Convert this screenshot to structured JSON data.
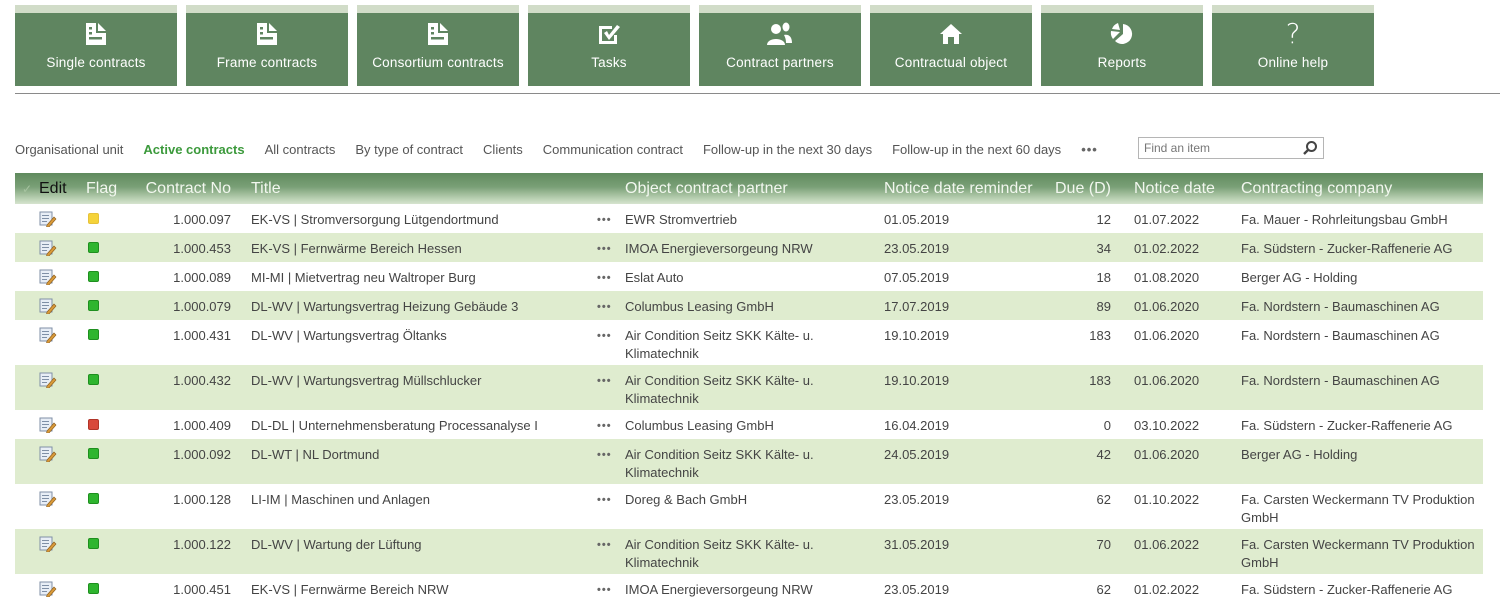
{
  "nav_tiles": [
    {
      "label": "Single contracts",
      "icon": "document-icon"
    },
    {
      "label": "Frame contracts",
      "icon": "document-icon"
    },
    {
      "label": "Consortium contracts",
      "icon": "document-icon"
    },
    {
      "label": "Tasks",
      "icon": "checkbox-icon"
    },
    {
      "label": "Contract partners",
      "icon": "people-icon"
    },
    {
      "label": "Contractual object",
      "icon": "home-icon"
    },
    {
      "label": "Reports",
      "icon": "pie-chart-icon"
    },
    {
      "label": "Online help",
      "icon": "question-icon",
      "glyph": "?"
    }
  ],
  "views": {
    "items": [
      {
        "label": "Organisational unit",
        "active": false
      },
      {
        "label": "Active contracts",
        "active": true
      },
      {
        "label": "All contracts",
        "active": false
      },
      {
        "label": "By type of contract",
        "active": false
      },
      {
        "label": "Clients",
        "active": false
      },
      {
        "label": "Communication contract",
        "active": false
      },
      {
        "label": "Follow-up in the next 30 days",
        "active": false
      },
      {
        "label": "Follow-up in the next 60 days",
        "active": false
      }
    ],
    "more": "•••"
  },
  "search": {
    "placeholder": "Find an item",
    "value": ""
  },
  "table": {
    "columns": {
      "select": "✓",
      "edit": "Edit",
      "flag": "Flag",
      "contract_no": "Contract No",
      "title": "Title",
      "partner": "Object contract partner",
      "reminder": "Notice date reminder",
      "due": "Due (D)",
      "notice": "Notice date",
      "company": "Contracting company"
    },
    "row_menu": "•••",
    "flag_colors": {
      "yellow": "#f5d33a",
      "green": "#2fb52f",
      "red": "#d8483a"
    },
    "rows": [
      {
        "flag": "yellow",
        "contract_no": "1.000.097",
        "title": "EK-VS | Stromversorgung Lütgendortmund",
        "partner": "EWR Stromvertrieb",
        "reminder": "01.05.2019",
        "due": "12",
        "notice": "01.07.2022",
        "company": "Fa. Mauer - Rohrleitungsbau GmbH"
      },
      {
        "flag": "green",
        "contract_no": "1.000.453",
        "title": "EK-VS | Fernwärme Bereich Hessen",
        "partner": "IMOA Energieversorgeung NRW",
        "reminder": "23.05.2019",
        "due": "34",
        "notice": "01.02.2022",
        "company": "Fa. Südstern - Zucker-Raffenerie AG"
      },
      {
        "flag": "green",
        "contract_no": "1.000.089",
        "title": "MI-MI | Mietvertrag neu Waltroper Burg",
        "partner": "Eslat Auto",
        "reminder": "07.05.2019",
        "due": "18",
        "notice": "01.08.2020",
        "company": "Berger AG - Holding"
      },
      {
        "flag": "green",
        "contract_no": "1.000.079",
        "title": "DL-WV | Wartungsvertrag Heizung Gebäude 3",
        "partner": "Columbus Leasing GmbH",
        "reminder": "17.07.2019",
        "due": "89",
        "notice": "01.06.2020",
        "company": "Fa. Nordstern - Baumaschinen AG"
      },
      {
        "flag": "green",
        "contract_no": "1.000.431",
        "title": "DL-WV | Wartungsvertrag Öltanks",
        "partner": "Air Condition Seitz SKK Kälte- u. Klimatechnik",
        "reminder": "19.10.2019",
        "due": "183",
        "notice": "01.06.2020",
        "company": "Fa. Nordstern - Baumaschinen AG"
      },
      {
        "flag": "green",
        "contract_no": "1.000.432",
        "title": "DL-WV | Wartungsvertrag Müllschlucker",
        "partner": "Air Condition Seitz SKK Kälte- u. Klimatechnik",
        "reminder": "19.10.2019",
        "due": "183",
        "notice": "01.06.2020",
        "company": "Fa. Nordstern - Baumaschinen AG"
      },
      {
        "flag": "red",
        "contract_no": "1.000.409",
        "title": "DL-DL | Unternehmensberatung Processanalyse I",
        "partner": "Columbus Leasing GmbH",
        "reminder": "16.04.2019",
        "due": "0",
        "notice": "03.10.2022",
        "company": "Fa. Südstern - Zucker-Raffenerie AG"
      },
      {
        "flag": "green",
        "contract_no": "1.000.092",
        "title": "DL-WT | NL Dortmund",
        "partner": "Air Condition Seitz SKK Kälte- u. Klimatechnik",
        "reminder": "24.05.2019",
        "due": "42",
        "notice": "01.06.2020",
        "company": "Berger AG - Holding"
      },
      {
        "flag": "green",
        "contract_no": "1.000.128",
        "title": "LI-IM | Maschinen und Anlagen",
        "partner": "Doreg & Bach GmbH",
        "reminder": "23.05.2019",
        "due": "62",
        "notice": "01.10.2022",
        "company": "Fa. Carsten Weckermann TV Produktion GmbH"
      },
      {
        "flag": "green",
        "contract_no": "1.000.122",
        "title": "DL-WV | Wartung der Lüftung",
        "partner": "Air Condition Seitz SKK Kälte- u. Klimatechnik",
        "reminder": "31.05.2019",
        "due": "70",
        "notice": "01.06.2022",
        "company": "Fa. Carsten Weckermann TV Produktion GmbH"
      },
      {
        "flag": "green",
        "contract_no": "1.000.451",
        "title": "EK-VS | Fernwärme Bereich NRW",
        "partner": "IMOA Energieversorgeung NRW",
        "reminder": "23.05.2019",
        "due": "62",
        "notice": "01.02.2022",
        "company": "Fa. Südstern - Zucker-Raffenerie AG"
      }
    ]
  },
  "colors": {
    "tile_bg": "#5f8560",
    "tile_top": "#d1dcc8",
    "active_view": "#3c9a3c",
    "row_alt": "#dfeccf"
  }
}
